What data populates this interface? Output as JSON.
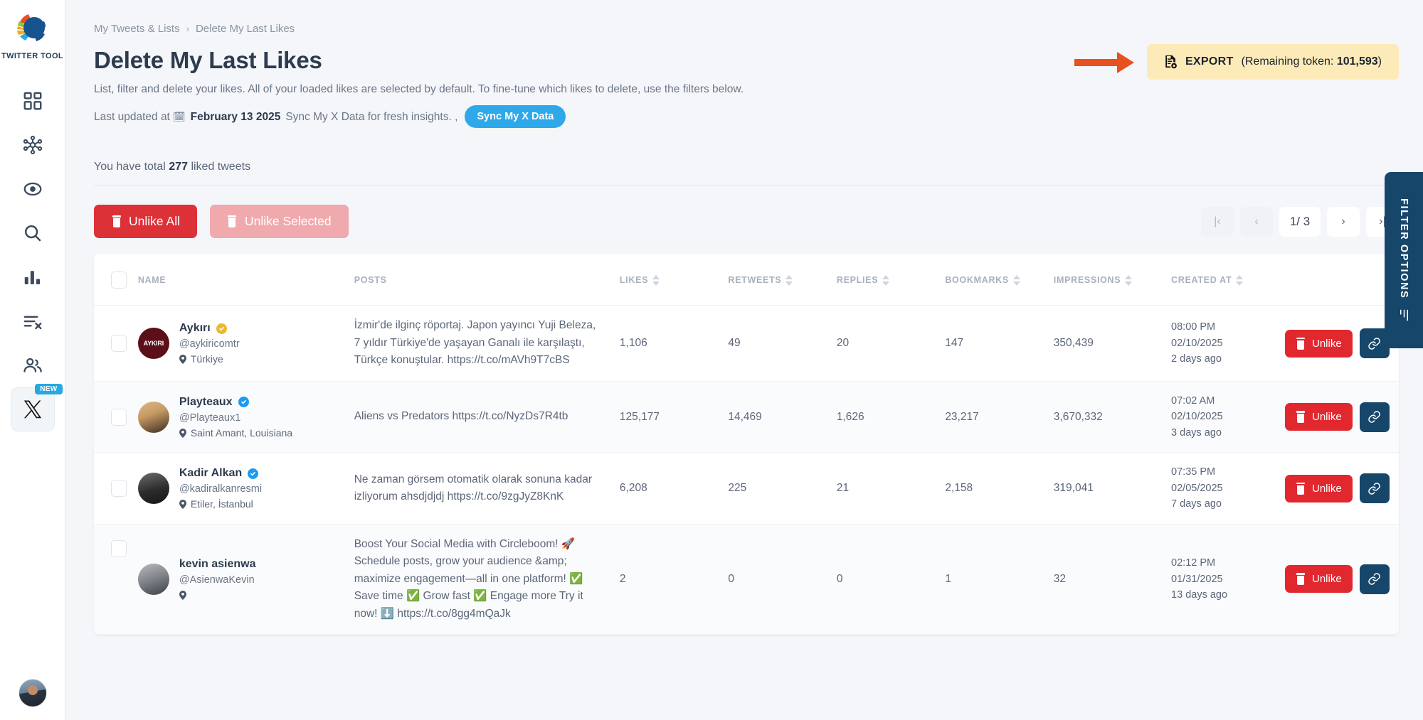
{
  "sidebar": {
    "brand_name": "TWITTER TOOL",
    "logo_icon": "circleboom-logo-icon",
    "items": [
      {
        "name": "dashboard",
        "icon": "grid-dashboard-icon"
      },
      {
        "name": "network",
        "icon": "network-nodes-icon"
      },
      {
        "name": "monitor",
        "icon": "eye-target-icon"
      },
      {
        "name": "search",
        "icon": "search-icon"
      },
      {
        "name": "analytics",
        "icon": "bar-chart-icon"
      },
      {
        "name": "delete-posts",
        "icon": "list-remove-icon"
      },
      {
        "name": "audience",
        "icon": "users-icon"
      },
      {
        "name": "x-platform",
        "icon": "x-logo-icon",
        "badge": "NEW"
      }
    ],
    "avatar_icon": "user-avatar"
  },
  "breadcrumb": {
    "parent": "My Tweets & Lists",
    "separator": "›",
    "current": "Delete My Last Likes"
  },
  "header": {
    "title": "Delete My Last Likes",
    "description": "List, filter and delete your likes. All of your loaded likes are selected by default. To fine-tune which likes to delete, use the filters below.",
    "last_updated_prefix": "Last updated at",
    "calendar_icon": "calendar-icon",
    "last_updated_date": "February 13 2025",
    "sync_hint": "Sync My X Data for fresh insights. ,",
    "sync_button": "Sync My X Data"
  },
  "export": {
    "arrow_icon": "arrow-right-indicator",
    "file_icon": "export-file-icon",
    "label": "EXPORT",
    "token_text": "(Remaining token: ",
    "token_value": "101,593",
    "token_close": ")",
    "bg_color": "#fdeab9",
    "arrow_color": "#e8511f"
  },
  "summary": {
    "prefix": "You have total",
    "count": "277",
    "suffix": "liked tweets"
  },
  "actions": {
    "unlike_all": "Unlike All",
    "unlike_selected": "Unlike Selected",
    "trash_icon": "trash-icon",
    "unlike_all_color": "#dd3138",
    "unlike_selected_color": "#f0a9ac"
  },
  "pagination": {
    "first_icon": "|‹",
    "prev_icon": "‹",
    "current": "1/ 3",
    "next_icon": "›",
    "last_icon": "›|"
  },
  "table": {
    "columns": [
      {
        "key": "check",
        "label": ""
      },
      {
        "key": "name",
        "label": "NAME",
        "sortable": false
      },
      {
        "key": "posts",
        "label": "POSTS",
        "sortable": false
      },
      {
        "key": "likes",
        "label": "LIKES",
        "sortable": true
      },
      {
        "key": "retweets",
        "label": "RETWEETS",
        "sortable": true
      },
      {
        "key": "replies",
        "label": "REPLIES",
        "sortable": true
      },
      {
        "key": "bookmarks",
        "label": "BOOKMARKS",
        "sortable": true
      },
      {
        "key": "impressions",
        "label": "IMPRESSIONS",
        "sortable": true
      },
      {
        "key": "created_at",
        "label": "CREATED AT",
        "sortable": true
      }
    ],
    "row_action": {
      "unlike_label": "Unlike",
      "link_icon": "link-chain-icon",
      "unlike_color": "#e0282e",
      "link_color": "#17466b"
    },
    "rows": [
      {
        "checked": false,
        "avatar_text": "AYKIRI",
        "name": "Aykırı",
        "verified": "gold",
        "handle": "@aykiricomtr",
        "location": "Türkiye",
        "post": "İzmir'de ilginç röportaj. Japon yayıncı Yuji Beleza, 7 yıldır Türkiye'de yaşayan Ganalı ile karşılaştı, Türkçe konuştular. https://t.co/mAVh9T7cBS",
        "likes": "1,106",
        "retweets": "49",
        "replies": "20",
        "bookmarks": "147",
        "impressions": "350,439",
        "time": "08:00 PM",
        "date": "02/10/2025",
        "relative": "2 days ago"
      },
      {
        "checked": false,
        "avatar_text": "",
        "name": "Playteaux",
        "verified": "blue",
        "handle": "@Playteaux1",
        "location": "Saint Amant, Louisiana",
        "post": "Aliens vs Predators https://t.co/NyzDs7R4tb",
        "likes": "125,177",
        "retweets": "14,469",
        "replies": "1,626",
        "bookmarks": "23,217",
        "impressions": "3,670,332",
        "time": "07:02 AM",
        "date": "02/10/2025",
        "relative": "3 days ago"
      },
      {
        "checked": false,
        "avatar_text": "",
        "name": "Kadir Alkan",
        "verified": "blue",
        "handle": "@kadiralkanresmi",
        "location": "Etiler, İstanbul",
        "post": "Ne zaman görsem otomatik olarak sonuna kadar izliyorum ahsdjdjdj https://t.co/9zgJyZ8KnK",
        "likes": "6,208",
        "retweets": "225",
        "replies": "21",
        "bookmarks": "2,158",
        "impressions": "319,041",
        "time": "07:35 PM",
        "date": "02/05/2025",
        "relative": "7 days ago"
      },
      {
        "checked": false,
        "avatar_text": "",
        "name": "kevin asienwa",
        "verified": "none",
        "handle": "@AsienwaKevin",
        "location": "",
        "post": "Boost Your Social Media with Circleboom! 🚀 Schedule posts, grow your audience &amp; maximize engagement—all in one platform! ✅ Save time ✅ Grow fast ✅ Engage more Try it now! ⬇️ https://t.co/8gg4mQaJk",
        "likes": "2",
        "retweets": "0",
        "replies": "0",
        "bookmarks": "1",
        "impressions": "32",
        "time": "02:12 PM",
        "date": "01/31/2025",
        "relative": "13 days ago"
      }
    ]
  },
  "filter_tab": {
    "label": "FILTER OPTIONS",
    "icon": "filter-sliders-icon",
    "bg_color": "#17466b"
  }
}
